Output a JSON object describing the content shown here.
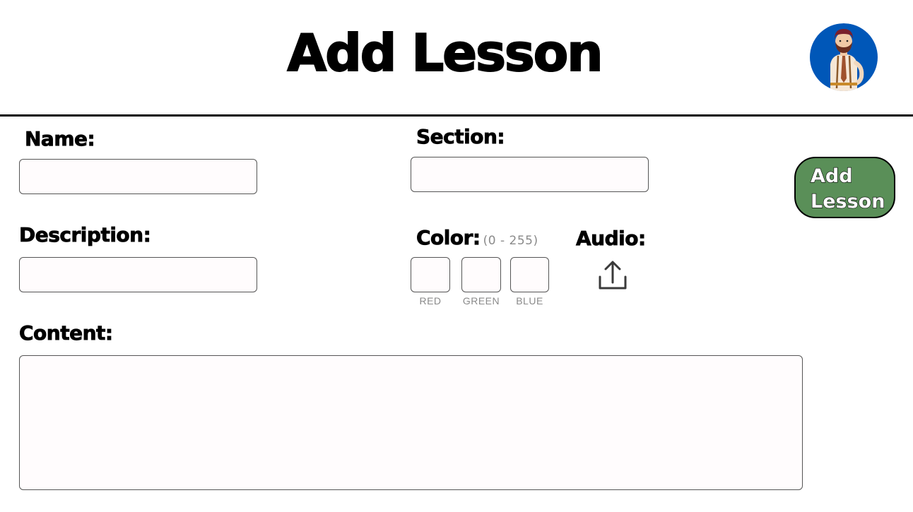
{
  "header": {
    "title": "Add Lesson",
    "avatar_icon": "teacher-avatar-icon",
    "avatar_bg": "#0057b8"
  },
  "form": {
    "name_label": "Name:",
    "section_label": "Section:",
    "description_label": "Description:",
    "color_label": "Color:",
    "color_hint": "(0 - 255)",
    "color_captions": {
      "red": "RED",
      "green": "GREEN",
      "blue": "BLUE"
    },
    "audio_label": "Audio:",
    "audio_icon": "upload-icon",
    "content_label": "Content:",
    "values": {
      "name": "",
      "section": "",
      "description": "",
      "red": "",
      "green": "",
      "blue": "",
      "content": ""
    }
  },
  "actions": {
    "add_button_label": "Add\nLesson",
    "add_button_color": "#5a8f58"
  }
}
